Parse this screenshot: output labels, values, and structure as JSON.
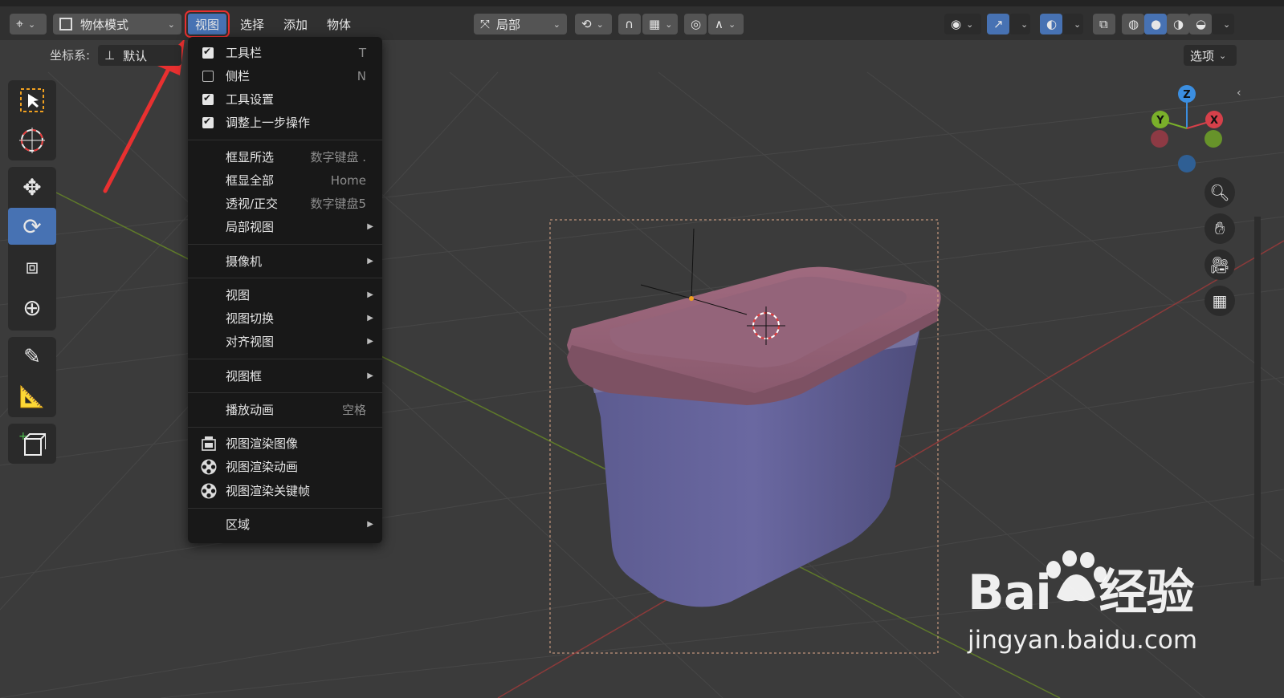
{
  "header": {
    "mode_label": "物体模式",
    "menus": [
      "视图",
      "选择",
      "添加",
      "物体"
    ],
    "transform_orientation": "局部",
    "options_label": "选项"
  },
  "subheader": {
    "coordinate_label": "坐标系:",
    "coordinate_value": "默认"
  },
  "view_menu": {
    "items": [
      {
        "label": "工具栏",
        "shortcut": "T",
        "checked": true
      },
      {
        "label": "侧栏",
        "shortcut": "N",
        "checked": false
      },
      {
        "label": "工具设置",
        "shortcut": "",
        "checked": true
      },
      {
        "label": "调整上一步操作",
        "shortcut": "",
        "checked": true
      },
      {
        "label": "框显所选",
        "shortcut": "数字键盘 ."
      },
      {
        "label": "框显全部",
        "shortcut": "Home"
      },
      {
        "label": "透视/正交",
        "shortcut": "数字键盘5"
      },
      {
        "label": "局部视图",
        "submenu": true
      },
      {
        "label": "摄像机",
        "submenu": true
      },
      {
        "label": "视图",
        "submenu": true
      },
      {
        "label": "视图切换",
        "submenu": true
      },
      {
        "label": "对齐视图",
        "submenu": true
      },
      {
        "label": "视图框",
        "submenu": true
      },
      {
        "label": "播放动画",
        "shortcut": "空格"
      },
      {
        "label": "视图渲染图像",
        "icon": "render-image-icon"
      },
      {
        "label": "视图渲染动画",
        "icon": "film-reel-icon"
      },
      {
        "label": "视图渲染关键帧",
        "icon": "film-reel-icon"
      },
      {
        "label": "区域",
        "submenu": true
      }
    ]
  },
  "gizmo": {
    "z": "Z",
    "y": "Y",
    "x": "X"
  },
  "watermark": {
    "brand": "Bai   经验",
    "url": "jingyan.baidu.com"
  },
  "colors": {
    "accent": "#4772b3",
    "highlight_box": "#e83030",
    "arrow": "#e83030",
    "menu_bg": "#181818"
  }
}
